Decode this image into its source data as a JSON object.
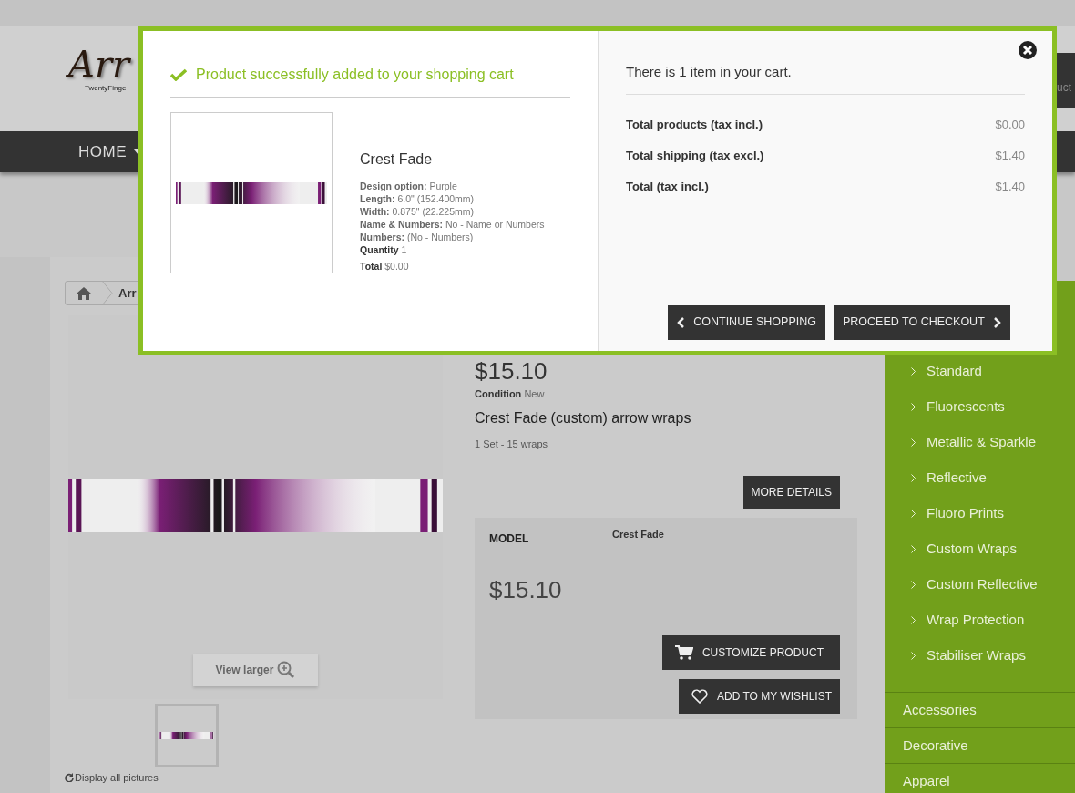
{
  "header": {
    "logo_text": "Arr",
    "logo_tagline": "TwentyFinge",
    "search_button_partial": "uct"
  },
  "nav": {
    "items": [
      {
        "label": "HOME",
        "has_dropdown": true
      }
    ]
  },
  "breadcrumb": {
    "items": [
      "Arr"
    ]
  },
  "product": {
    "price_top": "$15.10",
    "condition": "**Condition** New",
    "title": "Crest Fade (custom) arrow wraps",
    "short_description": "1 Set - 15 wraps",
    "more_details": "MORE DETAILS",
    "model_label": "MODEL",
    "model_value": "Crest Fade",
    "price": "$15.10",
    "customize_button": "CUSTOMIZE PRODUCT",
    "wishlist_button": "ADD TO MY WISHLIST",
    "view_larger": "View larger",
    "display_all_pictures": "Display all pictures"
  },
  "sidebar": {
    "items": [
      {
        "label": "Standard",
        "kind": "sub"
      },
      {
        "label": "Fluorescents",
        "kind": "sub"
      },
      {
        "label": "Metallic & Sparkle",
        "kind": "sub"
      },
      {
        "label": "Reflective",
        "kind": "sub"
      },
      {
        "label": "Fluoro Prints",
        "kind": "sub"
      },
      {
        "label": "Custom Wraps",
        "kind": "sub"
      },
      {
        "label": "Custom Reflective",
        "kind": "sub"
      },
      {
        "label": "Wrap Protection",
        "kind": "sub"
      },
      {
        "label": "Stabiliser Wraps",
        "kind": "sub"
      },
      {
        "label": "Accessories",
        "kind": "top"
      },
      {
        "label": "Decorative",
        "kind": "top"
      },
      {
        "label": "Apparel",
        "kind": "top"
      }
    ]
  },
  "modal": {
    "title": "Product successfully added to your shopping cart",
    "product_name": "Crest Fade",
    "attributes": [
      "**Design option:** Purple",
      "**Length:** 6.0\" (152.400mm)",
      "**Width:** 0.875\" (22.225mm)",
      "**Name & Numbers:** No - Name or Numbers",
      "**Numbers:** (No - Numbers)"
    ],
    "quantity": "**Quantity**  1",
    "total": "**Total**  $0.00",
    "cart_count": "There is 1 item in your cart.",
    "totals": [
      {
        "label": "Total products (tax incl.)",
        "value": "$0.00"
      },
      {
        "label": "Total shipping (tax excl.)",
        "value": "$1.40"
      },
      {
        "label": "Total (tax incl.)",
        "value": "$1.40"
      }
    ],
    "continue_button": "CONTINUE SHOPPING",
    "checkout_button": "PROCEED TO CHECKOUT"
  }
}
